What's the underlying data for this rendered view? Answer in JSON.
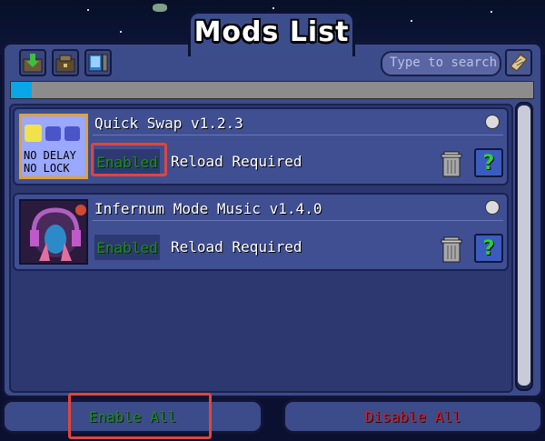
{
  "window": {
    "title": "Mods List"
  },
  "toolbar": {
    "buttons": [
      {
        "icon": "download-mods-icon"
      },
      {
        "icon": "mod-sources-icon"
      },
      {
        "icon": "mod-config-icon"
      }
    ],
    "search_placeholder": "Type to search",
    "search_icon": "filter-scroll-icon"
  },
  "progress": {
    "fraction": 0.04,
    "color": "#0aa7e8"
  },
  "mods": [
    {
      "name": "Quick Swap v1.2.3",
      "icon_text": [
        "NO DELAY",
        "NO LOCK"
      ],
      "status": "Enabled",
      "note": "Reload Required",
      "help": "?"
    },
    {
      "name": "Infernum Mode Music v1.4.0",
      "status": "Enabled",
      "note": "Reload Required",
      "help": "?"
    }
  ],
  "footer": {
    "enable_all": "Enable All",
    "disable_all": "Disable All"
  },
  "colors": {
    "enabled_text": "#1f8a1f",
    "disabled_text": "#cc1f1f",
    "highlight": "#e0453c",
    "panel": "#3c4b8a"
  }
}
